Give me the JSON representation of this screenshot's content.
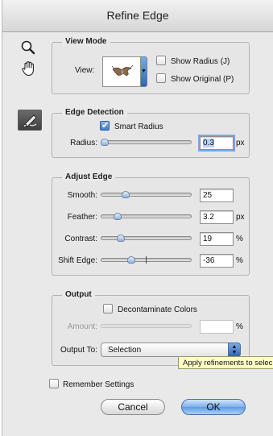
{
  "window": {
    "title": "Refine Edge"
  },
  "tools": [
    "zoom-icon",
    "hand-icon",
    "refine-radius-brush-icon"
  ],
  "view_mode": {
    "heading": "View Mode",
    "view_label": "View:",
    "show_radius": {
      "label": "Show Radius (J)",
      "checked": false
    },
    "show_original": {
      "label": "Show Original (P)",
      "checked": false
    }
  },
  "edge_detection": {
    "heading": "Edge Detection",
    "smart_radius": {
      "label": "Smart Radius",
      "checked": true
    },
    "radius": {
      "label": "Radius:",
      "value": "0.3",
      "unit": "px",
      "slider": 0.0
    }
  },
  "adjust_edge": {
    "heading": "Adjust Edge",
    "smooth": {
      "label": "Smooth:",
      "value": "25",
      "unit": "",
      "slider": 0.25
    },
    "feather": {
      "label": "Feather:",
      "value": "3.2",
      "unit": "px",
      "slider": 0.16
    },
    "contrast": {
      "label": "Contrast:",
      "value": "19",
      "unit": "%",
      "slider": 0.19
    },
    "shift_edge": {
      "label": "Shift Edge:",
      "value": "-36",
      "unit": "%",
      "slider": 0.32
    }
  },
  "output": {
    "heading": "Output",
    "decontaminate": {
      "label": "Decontaminate Colors",
      "checked": false
    },
    "amount": {
      "label": "Amount:",
      "value": "",
      "unit": "%"
    },
    "output_to": {
      "label": "Output To:",
      "value": "Selection"
    },
    "tooltip": "Apply refinements to selec"
  },
  "remember_settings": {
    "label": "Remember Settings",
    "checked": false
  },
  "buttons": {
    "cancel": "Cancel",
    "ok": "OK"
  },
  "colors": {
    "accent": "#5f9be4",
    "tooltip_bg": "#ffffc6"
  }
}
